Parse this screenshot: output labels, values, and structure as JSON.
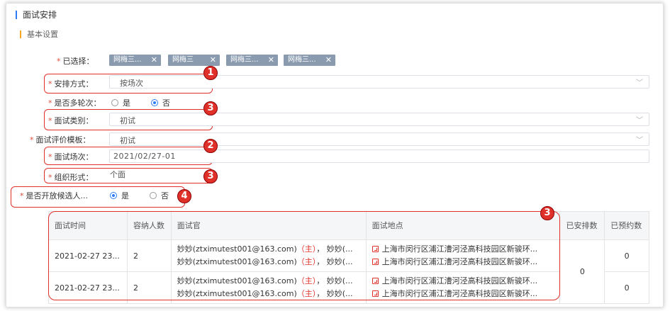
{
  "page": {
    "title": "面试安排",
    "section": "基本设置"
  },
  "form": {
    "selected": {
      "label": "已选择：",
      "tags": [
        "网梅三...",
        "网梅三",
        "网梅三...",
        "网梅三..."
      ]
    },
    "arrange": {
      "label": "安排方式：",
      "value": "按场次"
    },
    "multi_round": {
      "label": "是否多轮次：",
      "options": [
        "是",
        "否"
      ],
      "selected": "否"
    },
    "category": {
      "label": "面试类别：",
      "value": "初试"
    },
    "template": {
      "label": "面试评价模板：",
      "value": "初试"
    },
    "session": {
      "label": "面试场次：",
      "value": "2021/02/27-01"
    },
    "format": {
      "label": "组织形式：",
      "value": "个面"
    },
    "open_reserve": {
      "label": "是否开放候选人...",
      "options": [
        "是",
        "否"
      ],
      "selected": "是"
    }
  },
  "badges": [
    "1",
    "3",
    "2",
    "3",
    "4",
    "3"
  ],
  "table": {
    "headers": [
      "面试时间",
      "容纳人数",
      "面试官",
      "面试地点",
      "已安排数",
      "已预约数"
    ],
    "rows": [
      {
        "time": "2021-02-27 23...",
        "capacity": "2",
        "interviewers": [
          "妙妙(ztximutest001@163.com)",
          "妙妙(ztximutest001@163.com)"
        ],
        "host_tag": "（主）",
        "tail": "，   妙妙(...",
        "locations": [
          "上海市闵行区浦江漕河泾高科技园区新骏环...",
          "上海市闵行区浦江漕河泾高科技园区新骏环..."
        ],
        "reserved": "0"
      },
      {
        "time": "2021-02-27 23...",
        "capacity": "2",
        "interviewers": [
          "妙妙(ztximutest001@163.com)",
          "妙妙(ztximutest001@163.com)"
        ],
        "host_tag": "（主）",
        "tail": "，   妙妙(...",
        "locations": [
          "上海市闵行区浦江漕河泾高科技园区新骏环...",
          "上海市闵行区浦江漕河泾高科技园区新骏环..."
        ],
        "reserved": "0"
      }
    ],
    "arranged": "0"
  }
}
